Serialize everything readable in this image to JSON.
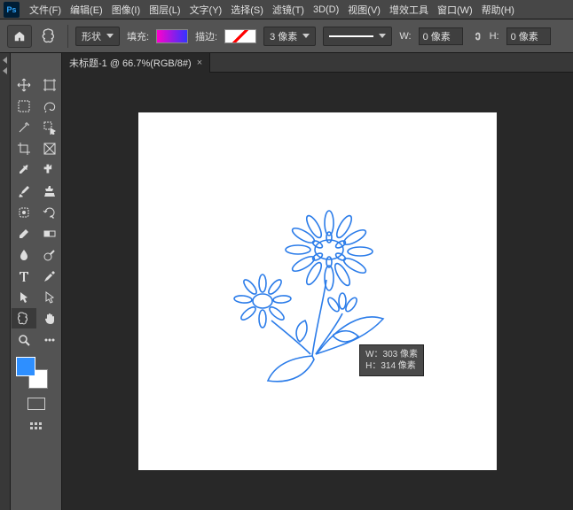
{
  "menu": {
    "items": [
      "文件(F)",
      "编辑(E)",
      "图像(I)",
      "图层(L)",
      "文字(Y)",
      "选择(S)",
      "滤镜(T)",
      "3D(D)",
      "视图(V)",
      "增效工具",
      "窗口(W)",
      "帮助(H)"
    ]
  },
  "options": {
    "shape_mode": "形状",
    "fill_label": "填充:",
    "stroke_label": "描边:",
    "stroke_width": "3 像素",
    "width_label": "W:",
    "width_value": "0 像素",
    "height_label": "H:",
    "height_value": "0 像素"
  },
  "tab": {
    "title": "未标题-1 @ 66.7%(RGB/8#)",
    "close": "×"
  },
  "tooltip": {
    "w": "W：303 像素",
    "h": "H：314 像素"
  },
  "tools": [
    "move",
    "artboard",
    "marquee",
    "lasso",
    "wand",
    "crop-perspective",
    "frame",
    "placeholder",
    "eyedropper",
    "ruler",
    "brush",
    "crop",
    "patch",
    "slice",
    "healing",
    "clone",
    "eraser",
    "paint-bucket",
    "gradient",
    "blur",
    "pen",
    "type",
    "path-select",
    "hand",
    "custom-shape",
    "hand2",
    "zoom",
    "edit-toolbar"
  ],
  "colors": {
    "fg": "#2e8fff",
    "bg": "#ffffff",
    "stroke": "#2b7ce9"
  }
}
